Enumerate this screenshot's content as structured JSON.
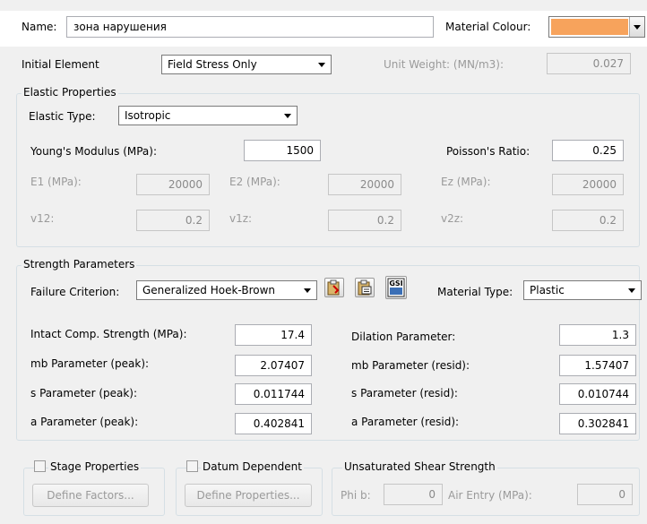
{
  "header": {
    "name_label": "Name:",
    "name_value": "зона нарушения",
    "material_colour_label": "Material Colour:",
    "material_colour": "#f7a35c"
  },
  "initial": {
    "initial_element_label": "Initial Element",
    "initial_element_value": "Field Stress Only",
    "unit_weight_label": "Unit Weight: (MN/m3):",
    "unit_weight_value": "0.027"
  },
  "elastic": {
    "group_title": "Elastic Properties",
    "elastic_type_label": "Elastic Type:",
    "elastic_type_value": "Isotropic",
    "youngs_label": "Young's Modulus (MPa):",
    "youngs_value": "1500",
    "poisson_label": "Poisson's Ratio:",
    "poisson_value": "0.25",
    "e1_label": "E1 (MPa):",
    "e1_value": "20000",
    "e2_label": "E2 (MPa):",
    "e2_value": "20000",
    "ez_label": "Ez (MPa):",
    "ez_value": "20000",
    "v12_label": "v12:",
    "v12_value": "0.2",
    "v1z_label": "v1z:",
    "v1z_value": "0.2",
    "v2z_label": "v2z:",
    "v2z_value": "0.2"
  },
  "strength": {
    "group_title": "Strength Parameters",
    "failure_label": "Failure Criterion:",
    "failure_value": "Generalized Hoek-Brown",
    "gsi_icon_text": "GSI",
    "material_type_label": "Material Type:",
    "material_type_value": "Plastic",
    "intact_label": "Intact Comp. Strength (MPa):",
    "intact_value": "17.4",
    "dilation_label": "Dilation Parameter:",
    "dilation_value": "1.3",
    "mb_peak_label": "mb Parameter (peak):",
    "mb_peak_value": "2.07407",
    "mb_resid_label": "mb Parameter (resid):",
    "mb_resid_value": "1.57407",
    "s_peak_label": "s Parameter (peak):",
    "s_peak_value": "0.011744",
    "s_resid_label": "s Parameter (resid):",
    "s_resid_value": "0.010744",
    "a_peak_label": "a Parameter (peak):",
    "a_peak_value": "0.402841",
    "a_resid_label": "a Parameter (resid):",
    "a_resid_value": "0.302841"
  },
  "bottom": {
    "stage_label": "Stage Properties",
    "define_factors": "Define Factors...",
    "datum_label": "Datum Dependent",
    "define_properties": "Define Properties...",
    "unsat_title": "Unsaturated Shear Strength",
    "phib_label": "Phi b:",
    "phib_value": "0",
    "air_entry_label": "Air Entry (MPa):",
    "air_entry_value": "0"
  }
}
